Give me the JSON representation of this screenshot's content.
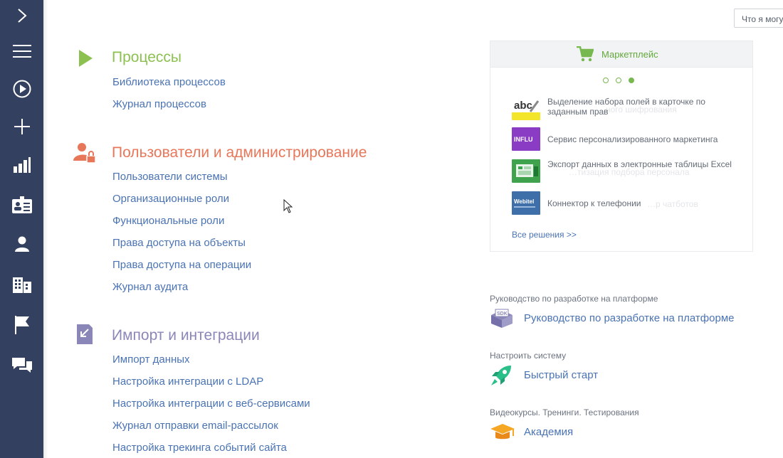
{
  "help_button": {
    "label": "Что я могу"
  },
  "sections": {
    "processes": {
      "title": "Процессы",
      "links": [
        "Библиотека процессов",
        "Журнал процессов"
      ]
    },
    "users": {
      "title": "Пользователи и администрирование",
      "links": [
        "Пользователи системы",
        "Организационные роли",
        "Функциональные роли",
        "Права доступа на объекты",
        "Права доступа на операции",
        "Журнал аудита"
      ]
    },
    "import": {
      "title": "Импорт и интеграции",
      "links": [
        "Импорт данных",
        "Настройка интеграции с LDAP",
        "Настройка интеграции с веб-сервисами",
        "Журнал отправки email-рассылок",
        "Настройка трекинга событий сайта"
      ]
    }
  },
  "marketplace": {
    "title": "Маркетплейс",
    "items": [
      {
        "text": "Выделение набора полей в карточке по заданным прав",
        "ghost": "…ного шифрования",
        "thumb": "abc"
      },
      {
        "text": "Сервис персонализированного маркетинга",
        "thumb": "INFLU"
      },
      {
        "text": "Экспорт данных в электронные таблицы Excel",
        "ghost": "…тизация подбора персонала",
        "thumb": ""
      },
      {
        "text": "Коннектор к телефонии",
        "ghost": "…р чатботов",
        "thumb": "Webitel"
      }
    ],
    "all_label": "Все решения >>"
  },
  "resources": [
    {
      "caption": "Руководство по разработке на платформе",
      "link": "Руководство по разработке на платформе",
      "icon": "sdk-icon"
    },
    {
      "caption": "Настроить систему",
      "link": "Быстрый старт",
      "icon": "rocket-icon"
    },
    {
      "caption": "Видеокурсы. Тренинги. Тестирования",
      "link": "Академия",
      "icon": "graduation-cap-icon"
    }
  ],
  "colors": {
    "nav_bg": "#334060",
    "processes": "#8cc152",
    "users": "#e8775a",
    "import": "#8a87b8",
    "link": "#4a73b4",
    "market_green": "#62a83a"
  }
}
